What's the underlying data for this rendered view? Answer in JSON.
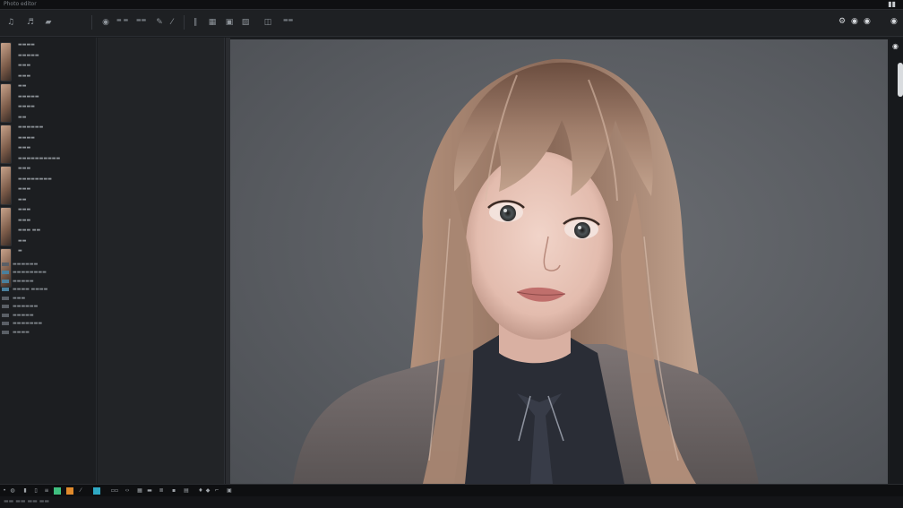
{
  "app": {
    "title": "Photo editor",
    "window_controls_icon": "window-controls-icon"
  },
  "toolbar": {
    "tools": [
      {
        "name": "music-icon",
        "glyph": "♫"
      },
      {
        "name": "music-note-icon",
        "glyph": "♬"
      },
      {
        "name": "folder-icon",
        "glyph": "▰"
      },
      {
        "name": "globe-icon",
        "glyph": "◉"
      }
    ],
    "mid_tools": [
      {
        "name": "columns-icon",
        "glyph": "∥"
      },
      {
        "name": "grid-icon",
        "glyph": "▦"
      },
      {
        "name": "camera-icon",
        "glyph": "▣"
      },
      {
        "name": "image-icon",
        "glyph": "▨"
      },
      {
        "name": "layout-icon",
        "glyph": "◫"
      }
    ],
    "right_controls": [
      "◉",
      "◉",
      "◉",
      "◉"
    ]
  },
  "left_panel": {
    "thumbnails": 6,
    "properties": [
      "",
      "",
      "",
      "",
      "",
      "",
      "",
      "",
      "",
      "",
      "",
      "",
      "",
      "",
      "",
      "",
      "",
      "",
      "",
      "",
      ""
    ],
    "layers": [
      "",
      "",
      "",
      "",
      "",
      "",
      "",
      "",
      ""
    ]
  },
  "canvas": {
    "subject": "portrait",
    "background": "#5e6166"
  },
  "statusbar": {
    "items": [
      "",
      "",
      "",
      "",
      "",
      "",
      "",
      "",
      "",
      "",
      "",
      "",
      "",
      "",
      "",
      "",
      ""
    ],
    "swatch_accent": "#2fa9c4",
    "swatch_green": "#3fbf7f",
    "swatch_orange": "#e08a2c"
  },
  "colors": {
    "chrome": "#1a1c1f",
    "toolbar": "#1e2023",
    "accent": "#2fa9c4"
  }
}
